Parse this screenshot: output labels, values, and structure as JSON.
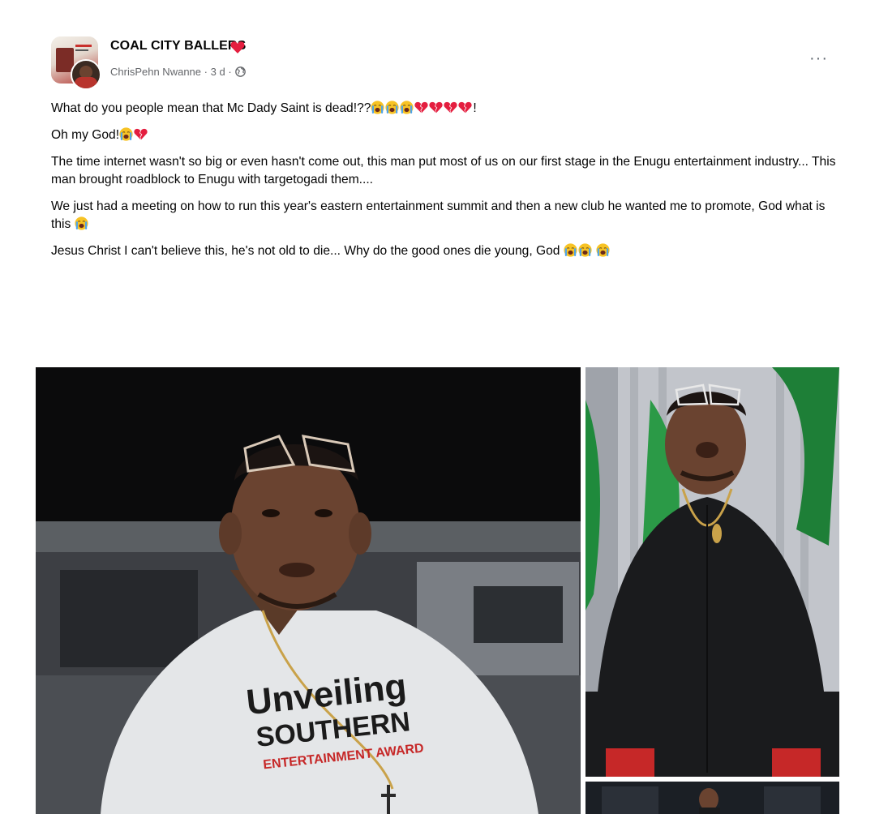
{
  "post": {
    "group_name": "COAL CITY BALLERS",
    "author": "ChrisPehn Nwanne",
    "timestamp": "3 d",
    "separator": "·",
    "audience_icon": "globe-icon",
    "more_label": "···",
    "paragraphs": {
      "p1": "What do you people mean that Mc Dady Saint is dead!??",
      "p1_end": "!",
      "p2": "Oh my God!",
      "p3": "The time internet wasn't so big or even hasn't come out, this man put most of us on our first stage in the Enugu entertainment industry... This man brought roadblock to Enugu with targetogadi them....",
      "p4": "We just had a meeting on how to run this year's eastern entertainment summit and then a new club he wanted me to promote, God what is this",
      "p5": "Jesus Christ I can't believe this, he's not old to die... Why do the good ones die young, God"
    },
    "photo_shirt_text": {
      "line1": "Unveiling",
      "line2": "SOUTHERN",
      "line3": "ENTERTAINMENT AWARD"
    }
  },
  "colors": {
    "text": "#050505",
    "meta": "#65676b",
    "heart": "#e41e3f",
    "broken_heart": "#e41e3f",
    "crying_face": "#f7c325",
    "tears": "#4fa3e8"
  }
}
